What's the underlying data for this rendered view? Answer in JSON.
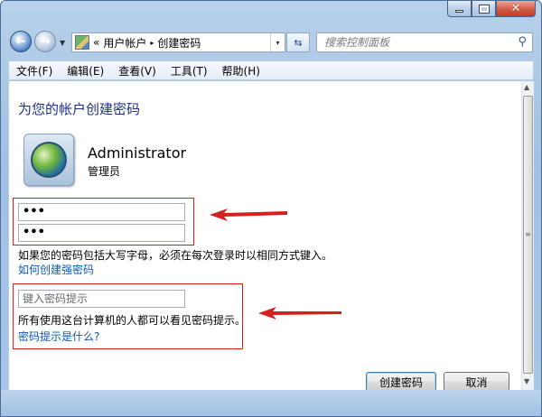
{
  "window": {
    "caption_buttons": [
      "minimize",
      "maximize",
      "close"
    ]
  },
  "nav": {
    "back_icon": "back-arrow-icon",
    "forward_icon": "forward-arrow-icon",
    "recent_icon": "chevron-down-icon"
  },
  "address": {
    "prefix": "«",
    "crumbs": [
      "用户帐户",
      "创建密码"
    ],
    "separator": "▸",
    "dropdown": "▾"
  },
  "search": {
    "placeholder": "搜索控制面板",
    "icon": "search-icon"
  },
  "menu": {
    "items": [
      "文件(F)",
      "编辑(E)",
      "查看(V)",
      "工具(T)",
      "帮助(H)"
    ]
  },
  "main": {
    "title": "为您的帐户创建密码",
    "user": {
      "name": "Administrator",
      "role": "管理员"
    },
    "password": {
      "new_value": "•••",
      "confirm_value": "•••"
    },
    "caps_note": "如果您的密码包括大写字母，必须在每次登录时以相同方式键入。",
    "strong_link": "如何创建强密码",
    "hint": {
      "placeholder": "键入密码提示",
      "value": ""
    },
    "hint_note": "所有使用这台计算机的人都可以看见密码提示。",
    "hint_link": "密码提示是什么?"
  },
  "buttons": {
    "create": "创建密码",
    "cancel": "取消"
  },
  "colors": {
    "title": "#1e3287",
    "link": "#0b5ab3",
    "annotation_red": "#d62020"
  }
}
